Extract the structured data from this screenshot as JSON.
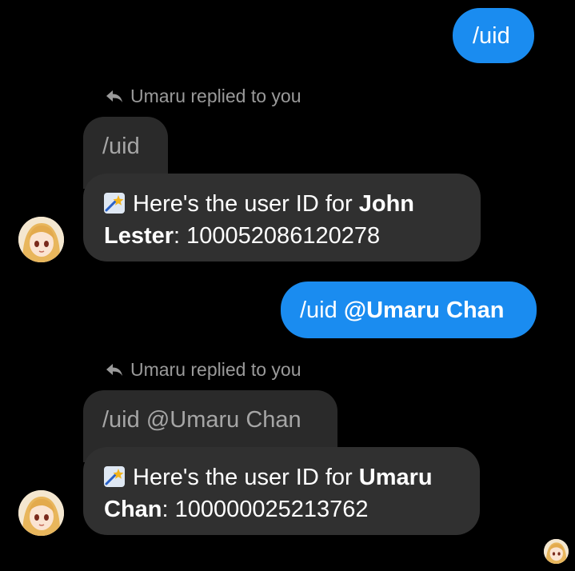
{
  "conversation": {
    "messages": [
      {
        "type": "outgoing",
        "text": "/uid"
      },
      {
        "type": "incoming_reply",
        "replied_label": "Umaru replied to you",
        "quoted_text": "/uid",
        "prefix": "Here's the user ID for ",
        "name": "John Lester",
        "name_line1": "John",
        "name_line2": "Lester",
        "suffix": ": 100052086120278",
        "icon": "bot-sparkle-icon"
      },
      {
        "type": "outgoing",
        "text_prefix": "/uid ",
        "mention": "@Umaru Chan"
      },
      {
        "type": "incoming_reply",
        "replied_label": "Umaru replied to you",
        "quoted_text": "/uid @Umaru Chan",
        "prefix": "Here's the user ID for ",
        "name": "Umaru Chan",
        "name_line1": "Umaru",
        "name_line2": "Chan",
        "suffix": ": 100000025213762",
        "icon": "bot-sparkle-icon"
      }
    ]
  },
  "colors": {
    "background": "#000000",
    "outgoing_bubble": "#1a8cf0",
    "incoming_bubble": "#303030",
    "quoted_bubble": "#2a2a2a",
    "secondary_text": "#9a9a9a"
  }
}
